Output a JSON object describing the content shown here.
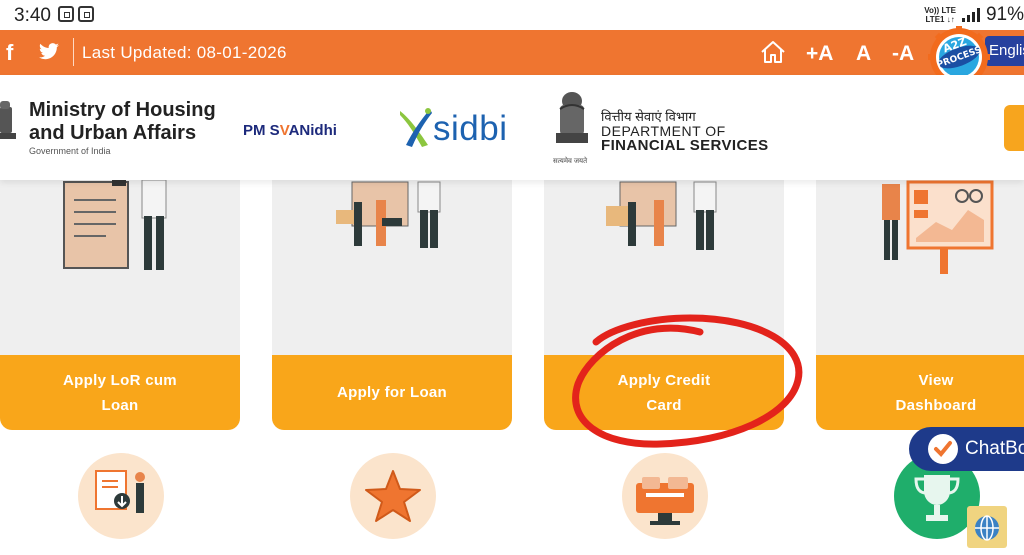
{
  "status_bar": {
    "time": "3:40",
    "net_top": "Vo)) LTE",
    "net_bottom": "LTE1 ↓↑",
    "battery": "91%"
  },
  "top_bar": {
    "last_updated": "Last Updated: 08-01-2026",
    "font_increase": "+A",
    "font_normal": "A",
    "font_decrease": "-A",
    "language": "English"
  },
  "header": {
    "mohua_title": "Ministry of Housing and Urban Affairs",
    "mohua_sub": "Government of India",
    "pm_prefix": "PM S",
    "pm_v": "V",
    "pm_suffix": "ANidhi",
    "sidbi": "sidbi",
    "dfs_hindi": "वित्तीय सेवाएं विभाग",
    "dfs_dept": "DEPARTMENT OF",
    "dfs_fin": "FINANCIAL SERVICES",
    "dfs_motto": "सत्यमेव जयते"
  },
  "cards": [
    {
      "label": "Apply LoR cum Loan"
    },
    {
      "label": "Apply for Loan"
    },
    {
      "label": "Apply Credit Card"
    },
    {
      "label": "View Dashboard"
    }
  ],
  "chatbot": {
    "label": "ChatBot"
  },
  "colors": {
    "orange_bar": "#ef7530",
    "card_button": "#f9a61a",
    "card_bg": "#efefef",
    "chat_bg": "#1e3a8a",
    "annotation": "#e3231b"
  }
}
